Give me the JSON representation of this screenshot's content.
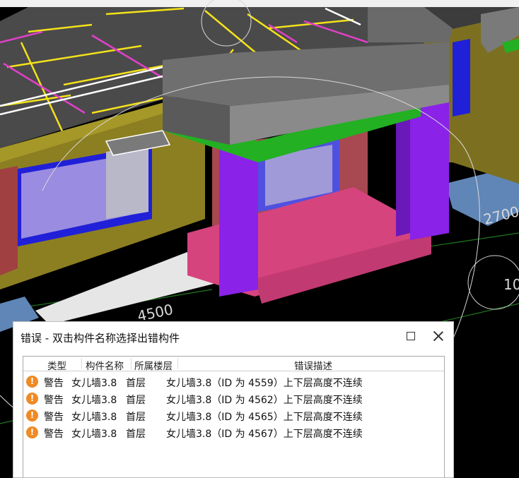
{
  "viewport": {
    "dimension_labels": [
      "2700",
      "4500",
      "10"
    ],
    "colors": {
      "background": "#000000",
      "wall": "#8c7f22",
      "column": "#8a22e8",
      "beam": "#23b023",
      "slab": "#d6447e",
      "roof": "#6f6f6f"
    }
  },
  "dialog": {
    "title": "错误 - 双击构件名称选择出错构件",
    "maximize_icon": "maximize-icon",
    "close_icon": "close-icon",
    "columns": {
      "type": "类型",
      "name": "构件名称",
      "floor": "所属楼层",
      "desc": "错误描述"
    },
    "rows": [
      {
        "icon": "warning-icon",
        "type": "警告",
        "name": "女儿墙3.8",
        "floor": "首层",
        "desc": "女儿墙3.8（ID 为 4559）上下层高度不连续"
      },
      {
        "icon": "warning-icon",
        "type": "警告",
        "name": "女儿墙3.8",
        "floor": "首层",
        "desc": "女儿墙3.8（ID 为 4562）上下层高度不连续"
      },
      {
        "icon": "warning-icon",
        "type": "警告",
        "name": "女儿墙3.8",
        "floor": "首层",
        "desc": "女儿墙3.8（ID 为 4565）上下层高度不连续"
      },
      {
        "icon": "warning-icon",
        "type": "警告",
        "name": "女儿墙3.8",
        "floor": "首层",
        "desc": "女儿墙3.8（ID 为 4567）上下层高度不连续"
      }
    ],
    "colors": {
      "warning": "#f08a24"
    }
  }
}
